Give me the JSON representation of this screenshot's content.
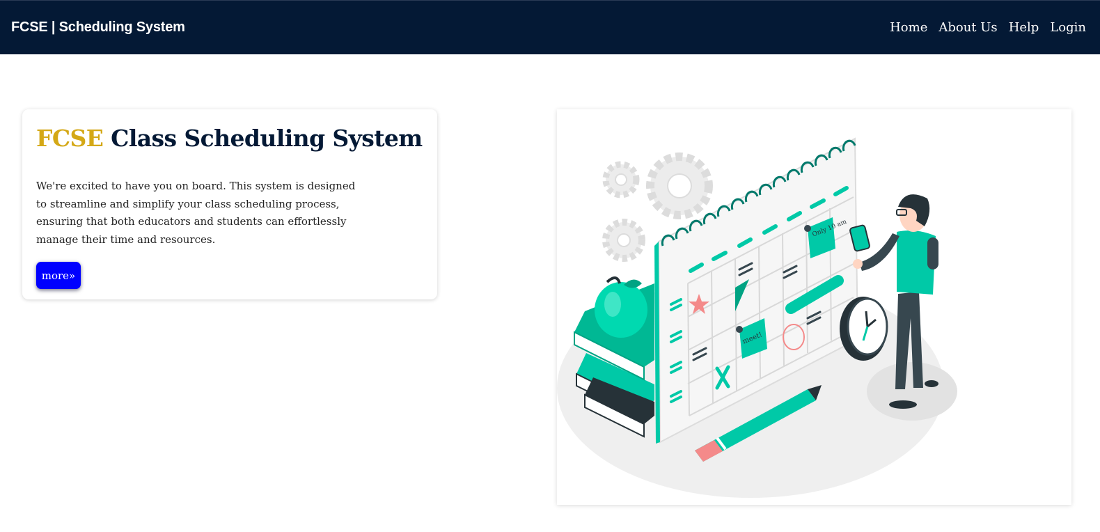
{
  "navbar": {
    "brand": "FCSE | Scheduling System",
    "links": [
      "Home",
      "About Us",
      "Help",
      "Login"
    ]
  },
  "hero": {
    "title_accent": "FCSE",
    "title_rest": " Class Scheduling System",
    "description": "We're excited to have you on board. This system is designed to streamline and simplify your class scheduling process, ensuring that both educators and students can effortlessly manage their time and resources.",
    "more_label": "more»"
  },
  "illustration": {
    "notes": [
      "Only 10 am",
      "meet!"
    ]
  },
  "colors": {
    "navbar_bg": "#041935",
    "accent_gold": "#d4a816",
    "title_navy": "#041935",
    "button_blue": "#0000ff",
    "illustration_teal": "#00c9a7"
  }
}
